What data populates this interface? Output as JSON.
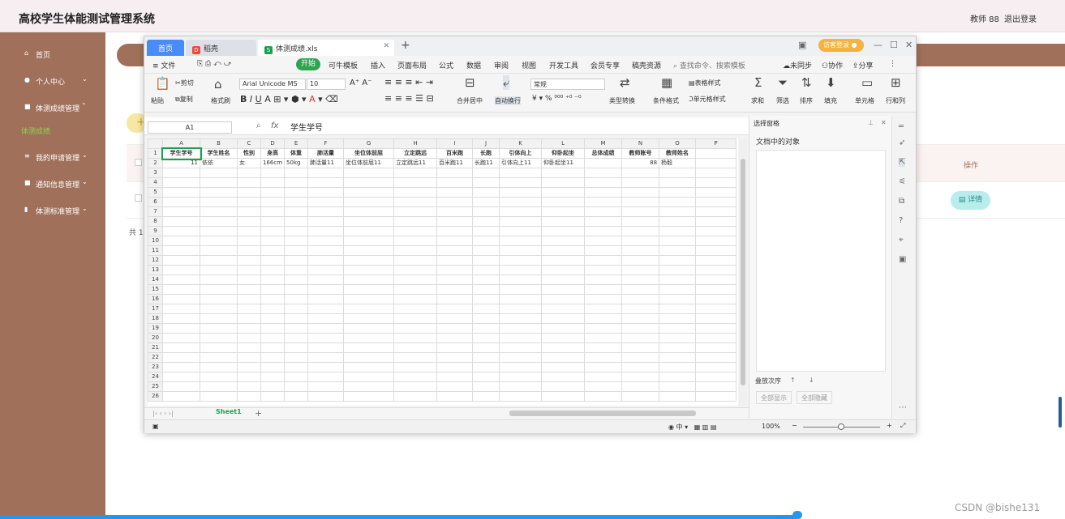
{
  "app": {
    "title": "高校学生体能测试管理系统",
    "teacher": "教师 88",
    "logout": "退出登录"
  },
  "sidebar": {
    "items": [
      {
        "label": "首页",
        "icon": "home-icon"
      },
      {
        "label": "个人中心",
        "icon": "user-icon"
      },
      {
        "label": "体测成绩管理",
        "icon": "grid-icon"
      },
      {
        "label": "我的申请管理",
        "icon": "list-icon"
      },
      {
        "label": "通知信息管理",
        "icon": "grid-icon"
      },
      {
        "label": "体测标准管理",
        "icon": "bars-icon"
      }
    ],
    "sub_item": "体测成绩"
  },
  "page": {
    "add_symbol": "+",
    "op_header": "操作",
    "detail_btn": "详情",
    "total": "共 1"
  },
  "wps": {
    "tabs": {
      "home": "首页",
      "docer": "稻壳",
      "file": "体测成绩.xls"
    },
    "visitor": "访客登录",
    "menus": [
      "文件",
      "可牛模板",
      "插入",
      "页面布局",
      "公式",
      "数据",
      "审阅",
      "视图",
      "开发工具",
      "会员专享",
      "稿壳资源"
    ],
    "menu_start": "开始",
    "search": "查找命令、搜索模板",
    "right_menus": [
      "未同步",
      "协作",
      "分享"
    ],
    "ribbon": {
      "paste": "粘贴",
      "cut": "剪切",
      "copy": "复制",
      "format_painter": "格式刷",
      "font": "Arial Unicode MS",
      "size": "10",
      "merge": "合并居中",
      "wrap": "自动换行",
      "numfmt": "常规",
      "convert": "类型转换",
      "cond": "条件格式",
      "table_style": "表格样式",
      "cell_style": "单元格样式",
      "sum": "求和",
      "filter": "筛选",
      "sort": "排序",
      "fill": "填充",
      "cell": "单元格",
      "rowcol": "行和列"
    },
    "namebox": "A1",
    "fx": "fx",
    "formula": "学生学号",
    "columns": [
      "A",
      "B",
      "C",
      "D",
      "E",
      "F",
      "G",
      "H",
      "I",
      "J",
      "K",
      "L",
      "M",
      "N",
      "O",
      "P"
    ],
    "header_row": [
      "学生学号",
      "学生姓名",
      "性别",
      "身高",
      "体重",
      "肺活量",
      "坐位体前屈",
      "立定跳远",
      "百米跑",
      "长跑",
      "引体向上",
      "仰卧起坐",
      "总体成绩",
      "教师账号",
      "教师姓名",
      ""
    ],
    "data_row": [
      "11",
      "依依",
      "女",
      "166cm",
      "50kg",
      "肺活量11",
      "坐位体前屈11",
      "立定跳远11",
      "百米跑11",
      "长跑11",
      "引体向上11",
      "仰卧起坐11",
      "",
      "88",
      "杨毅",
      ""
    ],
    "sheet": "Sheet1",
    "zoom": "100%",
    "pane": {
      "title": "选择窗格",
      "objects": "文档中的对象",
      "order": "叠放次序",
      "show_all": "全部显示",
      "hide_all": "全部隐藏"
    }
  },
  "watermark": "CSDN @bishe131"
}
